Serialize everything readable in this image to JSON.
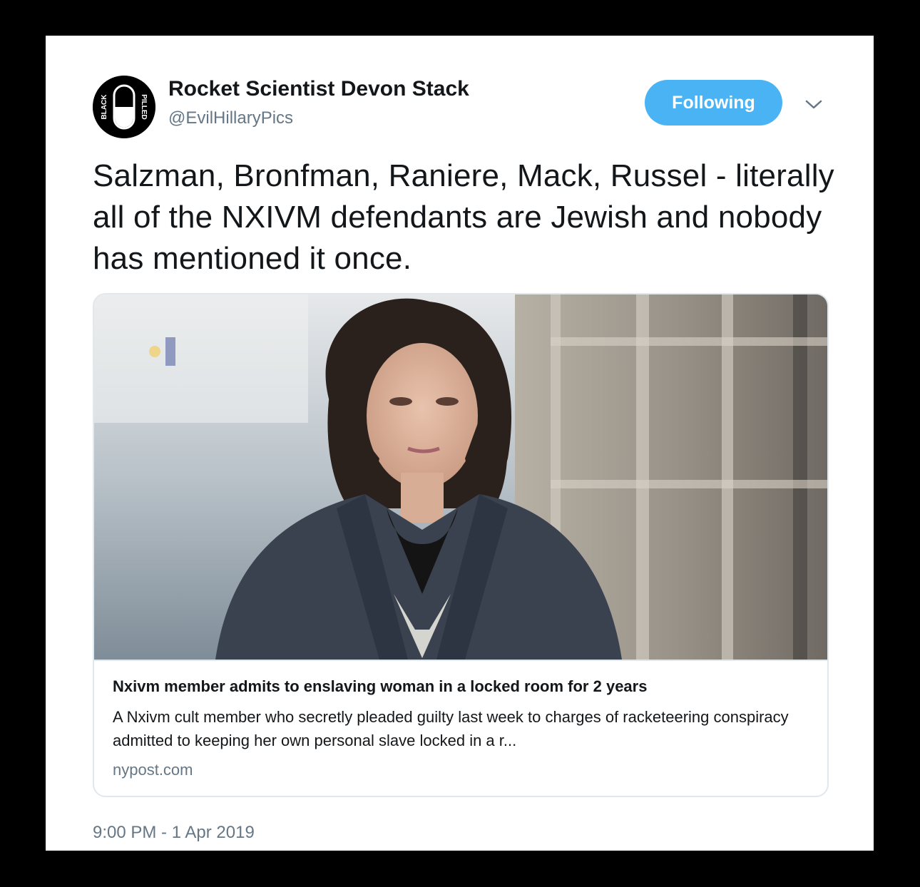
{
  "author": {
    "display_name": "Rocket Scientist Devon Stack",
    "handle": "@EvilHillaryPics",
    "avatar_text_left": "BLACK",
    "avatar_text_right": "PILLED"
  },
  "follow_button_label": "Following",
  "tweet_text": "Salzman, Bronfman, Raniere, Mack, Russel - literally all of the NXIVM defendants are Jewish and nobody has mentioned it once.",
  "link_card": {
    "title": "Nxivm member admits to enslaving woman in a locked room for 2 years",
    "description": "A Nxivm cult member who secretly pleaded guilty last week to charges of racketeering conspiracy admitted to keeping her own personal slave locked in a r...",
    "domain": "nypost.com"
  },
  "timestamp": "9:00 PM - 1 Apr 2019",
  "colors": {
    "follow_button": "#4ab3f4",
    "secondary_text": "#657786",
    "card_border": "#e1e8ed"
  },
  "icons": {
    "caret": "chevron-down-icon",
    "avatar": "pill-logo-icon"
  }
}
